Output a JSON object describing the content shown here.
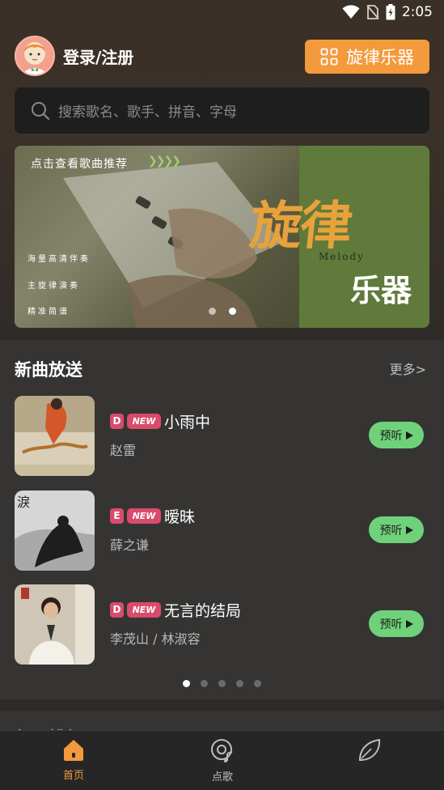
{
  "status_bar": {
    "time": "2:05"
  },
  "header": {
    "login_label": "登录/注册",
    "instrument_button_label": "旋律乐器"
  },
  "search": {
    "placeholder": "搜索歌名、歌手、拼音、字母"
  },
  "banner": {
    "recommend_text": "点击查看歌曲推荐",
    "features": [
      "海量高清伴奏",
      "主旋律演奏",
      "精准简谱"
    ],
    "title": "旋律",
    "melody_text": "Melody",
    "subtitle": "乐器",
    "page_count": 2,
    "active_page": 2
  },
  "new_songs": {
    "title": "新曲放送",
    "more_label": "更多>",
    "songs": [
      {
        "tag": "D",
        "new_label": "NEW",
        "title": "小雨中",
        "artist": "赵雷",
        "preview_label": "预听"
      },
      {
        "tag": "E",
        "new_label": "NEW",
        "title": "暧昧",
        "artist": "薛之谦",
        "preview_label": "预听"
      },
      {
        "tag": "D",
        "new_label": "NEW",
        "title": "无言的结局",
        "artist": "李茂山 / 林淑容",
        "preview_label": "预听"
      }
    ],
    "page_count": 5,
    "active_page": 1
  },
  "next_section": {
    "title": "每日排行"
  },
  "bottom_nav": [
    {
      "label": "首页",
      "icon": "home-icon",
      "active": true
    },
    {
      "label": "点歌",
      "icon": "disc-icon",
      "active": false
    },
    {
      "label": "",
      "icon": "leaf-icon",
      "active": false
    }
  ],
  "colors": {
    "accent_orange": "#f39a3c",
    "tag_pink": "#d94b6c",
    "preview_green": "#6fd27a",
    "banner_title": "#e9a23b"
  }
}
